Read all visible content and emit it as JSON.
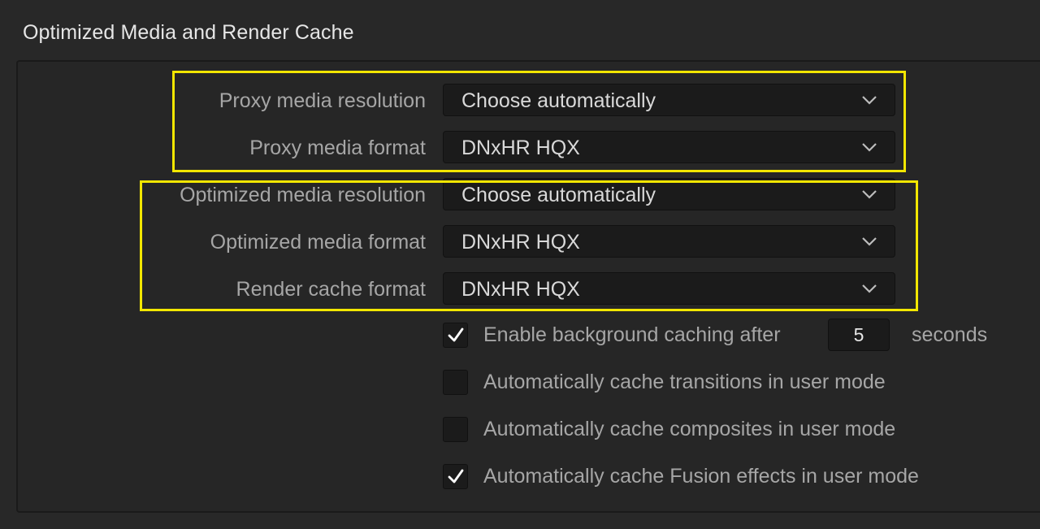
{
  "section": {
    "title": "Optimized Media and Render Cache"
  },
  "settings": [
    {
      "label": "Proxy media resolution",
      "value": "Choose automatically",
      "icon": "chevron-down-icon"
    },
    {
      "label": "Proxy media format",
      "value": "DNxHR HQX",
      "icon": "chevron-down-icon"
    },
    {
      "label": "Optimized media resolution",
      "value": "Choose automatically",
      "icon": "chevron-down-icon"
    },
    {
      "label": "Optimized media format",
      "value": "DNxHR HQX",
      "icon": "chevron-down-icon"
    },
    {
      "label": "Render cache format",
      "value": "DNxHR HQX",
      "icon": "chevron-down-icon"
    }
  ],
  "background_caching": {
    "checked": true,
    "label": "Enable background caching after",
    "value": "5",
    "unit": "seconds"
  },
  "options": [
    {
      "label": "Automatically cache transitions in user mode",
      "checked": false
    },
    {
      "label": "Automatically cache composites in user mode",
      "checked": false
    },
    {
      "label": "Automatically cache Fusion effects in user mode",
      "checked": true
    }
  ],
  "colors": {
    "background": "#282828",
    "highlight": "#f2e600",
    "field": "#1b1b1b",
    "label_text": "#a6a6a6"
  }
}
